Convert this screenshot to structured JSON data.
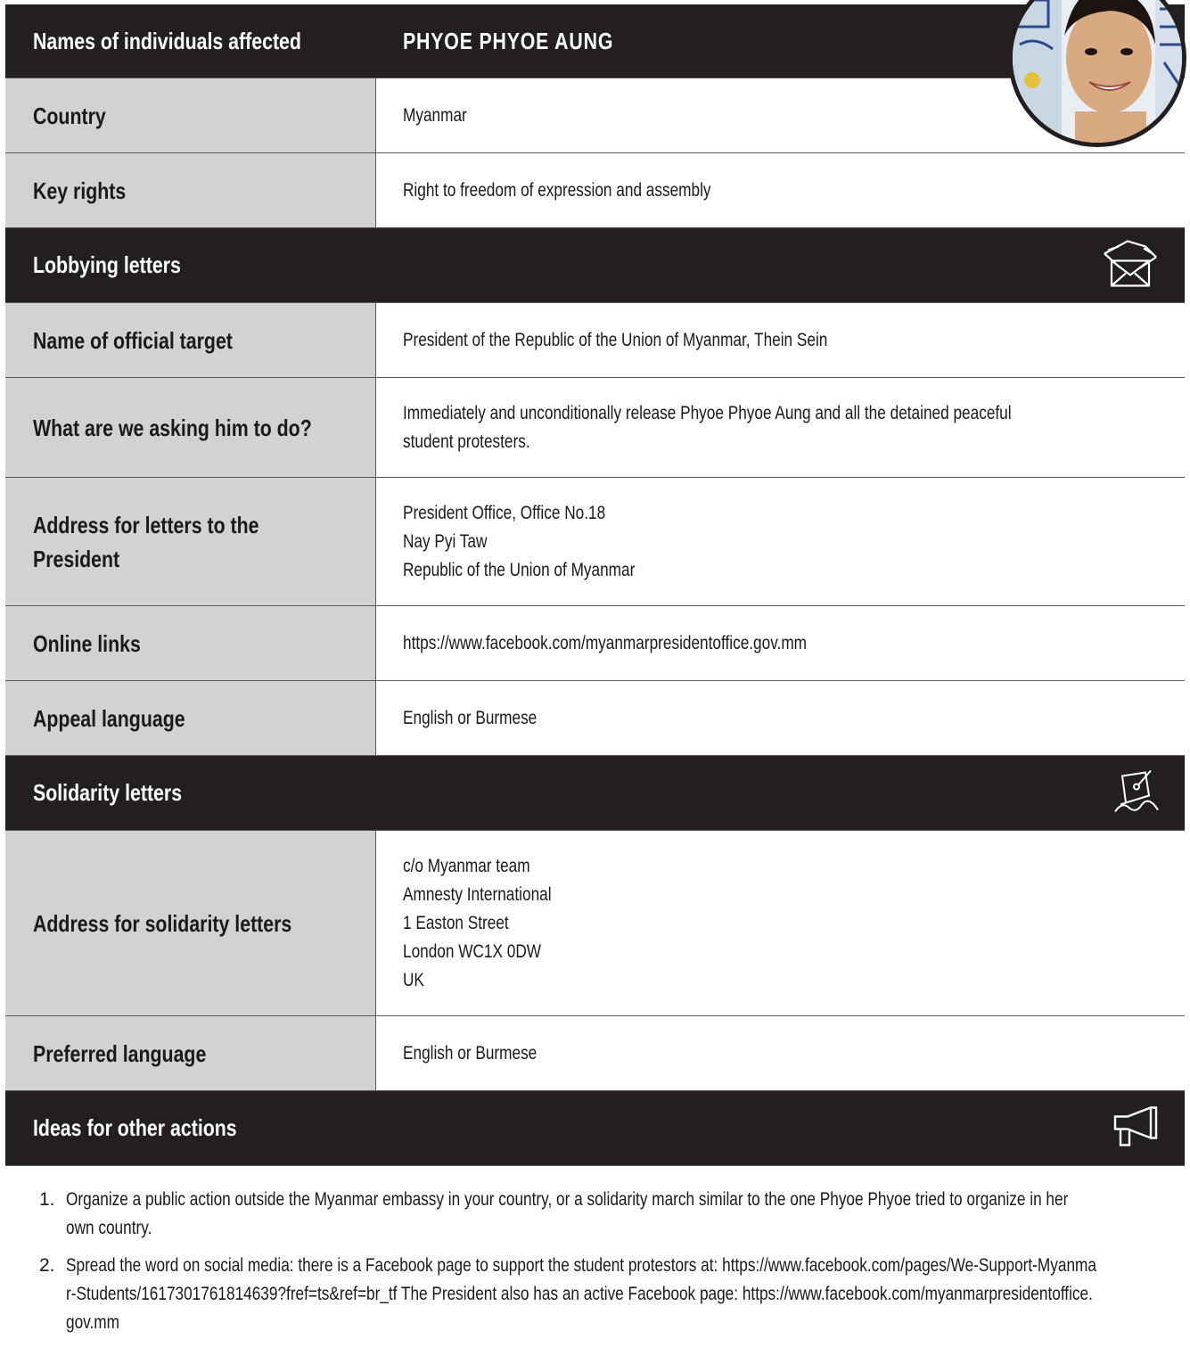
{
  "header": {
    "label": "Names of individuals affected",
    "value": "PHYOE PHYOE AUNG"
  },
  "rows_top": [
    {
      "label": "Country",
      "value": "Myanmar"
    },
    {
      "label": "Key rights",
      "value": "Right to freedom of expression and assembly"
    }
  ],
  "lobbying": {
    "title": "Lobbying letters",
    "icon": "envelope-icon",
    "rows": [
      {
        "label": "Name of official target",
        "value": "President of the Republic of the Union of Myanmar, Thein Sein"
      },
      {
        "label": "What are we asking him to do?",
        "value": "Immediately and unconditionally release Phyoe Phyoe Aung and all the detained peaceful student protesters."
      },
      {
        "label": "Address for letters to the President",
        "value": "President Office, Office No.18\nNay Pyi Taw\nRepublic of the Union of Myanmar"
      },
      {
        "label": "Online links",
        "value": "https://www.facebook.com/myanmarpresidentoffice.gov.mm"
      },
      {
        "label": "Appeal language",
        "value": "English or Burmese"
      }
    ]
  },
  "solidarity": {
    "title": "Solidarity letters",
    "icon": "pen-nib-icon",
    "rows": [
      {
        "label": "Address for solidarity letters",
        "value": "c/o Myanmar team\nAmnesty International\n1 Easton Street\nLondon WC1X 0DW\nUK"
      },
      {
        "label": "Preferred language",
        "value": "English or Burmese"
      }
    ]
  },
  "ideas": {
    "title": "Ideas for other actions",
    "icon": "megaphone-icon",
    "items": [
      {
        "num": "1.",
        "text": "Organize a public action outside the Myanmar embassy in your country, or a solidarity march similar to the one Phyoe Phyoe tried to organize in her own country."
      },
      {
        "num": "2.",
        "text": "Spread the word on social media: there is a Facebook page to support the student protestors at: https://www.facebook.com/pages/We-Support-Myanmar-Students/1617301761814639?fref=ts&ref=br_tf  The President also has an active Facebook page: https://www.facebook.com/myanmarpresidentoffice.gov.mm"
      }
    ]
  }
}
